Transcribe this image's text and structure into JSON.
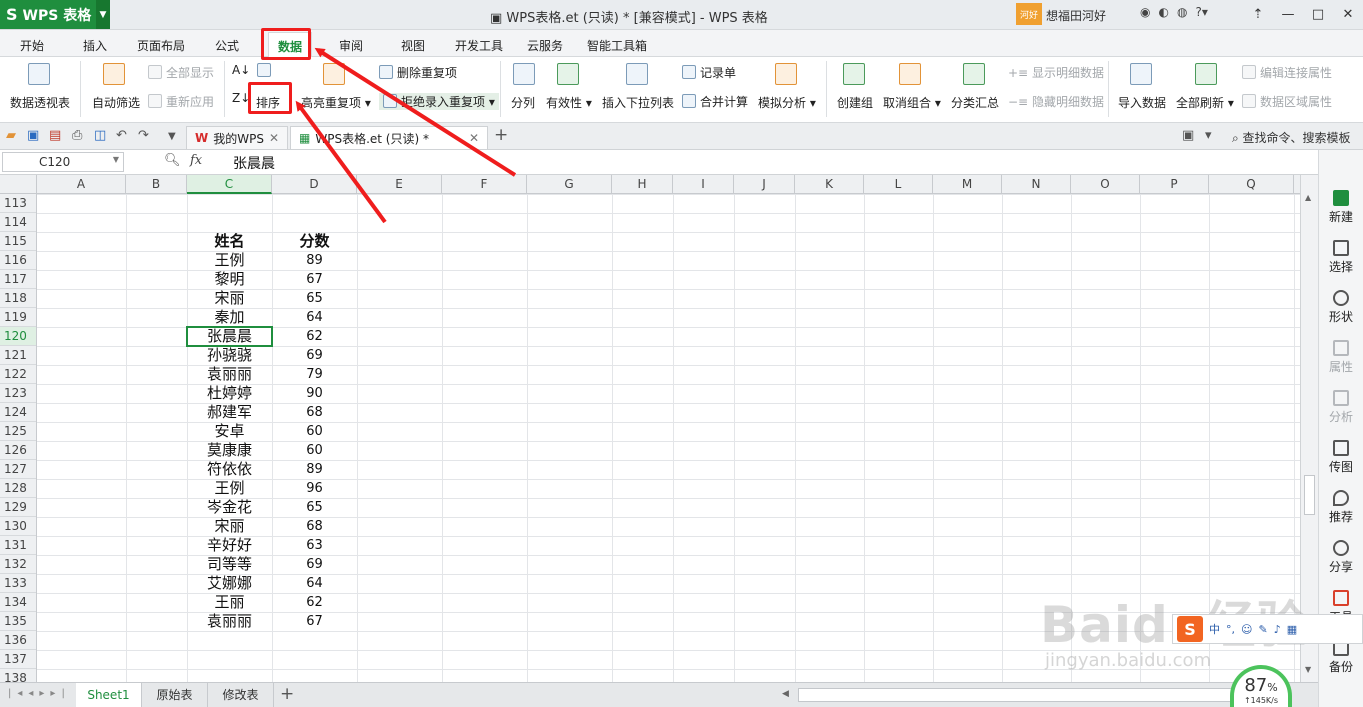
{
  "app": {
    "name": "WPS 表格",
    "window_title": "WPS表格.et (只读) * [兼容模式] - WPS 表格",
    "user_badge": "河好",
    "user_name": "想福田河好"
  },
  "menus": [
    {
      "label": "开始"
    },
    {
      "label": "插入"
    },
    {
      "label": "页面布局"
    },
    {
      "label": "公式"
    },
    {
      "label": "数据",
      "active": true
    },
    {
      "label": "审阅"
    },
    {
      "label": "视图"
    },
    {
      "label": "开发工具"
    },
    {
      "label": "云服务"
    },
    {
      "label": "智能工具箱"
    }
  ],
  "ribbon": {
    "pivot": "数据透视表",
    "autofilter": "自动筛选",
    "show_all": "全部显示",
    "reapply": "重新应用",
    "sort": "排序",
    "highlight_dup": "高亮重复项",
    "delete_dup": "删除重复项",
    "reject_dup": "拒绝录入重复项",
    "split": "分列",
    "validity": "有效性",
    "insert_dropdown": "插入下拉列表",
    "record_form": "记录单",
    "merge_calc": "合并计算",
    "simulate": "模拟分析",
    "create_group": "创建组",
    "ungroup": "取消组合",
    "subtotal": "分类汇总",
    "show_detail": "显示明细数据",
    "hide_detail": "隐藏明细数据",
    "import": "导入数据",
    "refresh_all": "全部刷新",
    "edit_conn": "编辑连接属性",
    "range_prop": "数据区域属性"
  },
  "tabs": {
    "my_wps": "我的WPS",
    "doc": "WPS表格.et (只读) *",
    "add": "+",
    "find": "查找命令、搜索模板"
  },
  "formula_bar": {
    "cell_ref": "C120",
    "fx": "fx",
    "value": "张晨晨"
  },
  "columns": [
    "A",
    "B",
    "C",
    "D",
    "E",
    "F",
    "G",
    "H",
    "I",
    "J",
    "K",
    "L",
    "M",
    "N",
    "O",
    "P",
    "Q"
  ],
  "row_numbers": [
    "113",
    "114",
    "115",
    "116",
    "117",
    "118",
    "119",
    "120",
    "121",
    "122",
    "123",
    "124",
    "125",
    "126",
    "127",
    "128",
    "129",
    "130",
    "131",
    "132",
    "133",
    "134",
    "135",
    "136",
    "137",
    "138"
  ],
  "table": {
    "headers": [
      "姓名",
      "分数"
    ],
    "rows": [
      [
        "王例",
        "89"
      ],
      [
        "黎明",
        "67"
      ],
      [
        "宋丽",
        "65"
      ],
      [
        "秦加",
        "64"
      ],
      [
        "张晨晨",
        "62"
      ],
      [
        "孙骁骁",
        "69"
      ],
      [
        "袁丽丽",
        "79"
      ],
      [
        "杜婷婷",
        "90"
      ],
      [
        "郝建军",
        "68"
      ],
      [
        "安卓",
        "60"
      ],
      [
        "莫康康",
        "60"
      ],
      [
        "符依依",
        "89"
      ],
      [
        "王例",
        "96"
      ],
      [
        "岑金花",
        "65"
      ],
      [
        "宋丽",
        "68"
      ],
      [
        "辛好好",
        "63"
      ],
      [
        "司等等",
        "69"
      ],
      [
        "艾娜娜",
        "64"
      ],
      [
        "王丽",
        "62"
      ],
      [
        "袁丽丽",
        "67"
      ]
    ]
  },
  "sheets": [
    "Sheet1",
    "原始表",
    "修改表"
  ],
  "sidebar": [
    "新建",
    "选择",
    "形状",
    "属性",
    "分析",
    "传图",
    "推荐",
    "分享",
    "工具",
    "备份"
  ],
  "overlay": {
    "speed_pct": "87",
    "pct_unit": "%",
    "speed_rate": "↑145K/s",
    "watermark": "Baidu经验",
    "watermark_url": "jingyan.baidu.com"
  },
  "colors": {
    "accent": "#1f8e3e",
    "highlight": "#ef1d1d"
  }
}
